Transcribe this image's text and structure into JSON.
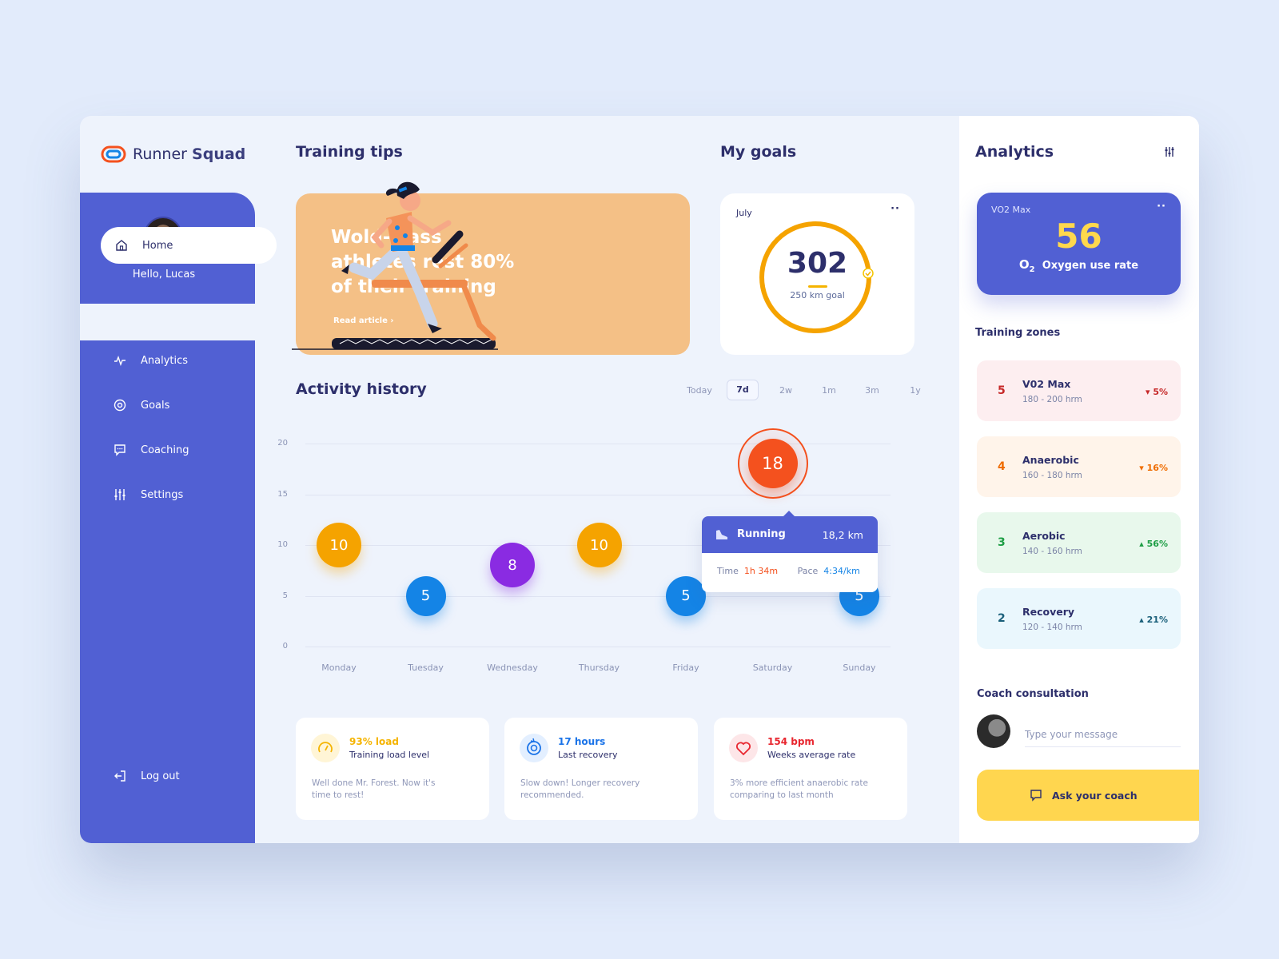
{
  "brand": {
    "name_regular": "Runner",
    "name_bold": "Squad"
  },
  "sidebar": {
    "greeting": "Hello, Lucas",
    "items": [
      {
        "label": "Home",
        "icon": "home-icon",
        "active": true
      },
      {
        "label": "Analytics",
        "icon": "pulse-icon"
      },
      {
        "label": "Goals",
        "icon": "target-icon"
      },
      {
        "label": "Coaching",
        "icon": "chat-icon"
      },
      {
        "label": "Settings",
        "icon": "sliders-icon"
      }
    ],
    "logout": "Log out"
  },
  "tips": {
    "heading": "Training tips",
    "title": "Wold-class athletes rest 80% of their training",
    "link": "Read article"
  },
  "goals": {
    "heading": "My goals",
    "month": "July",
    "value": "302",
    "goal_label": "250 km goal",
    "progress": 1.0
  },
  "activity": {
    "heading": "Activity history",
    "ranges": [
      "Today",
      "7d",
      "2w",
      "1m",
      "3m",
      "1y"
    ],
    "active_range": "7d",
    "tooltip": {
      "activity": "Running",
      "distance": "18,2 km",
      "time_label": "Time",
      "time_value": "1h 34m",
      "pace_label": "Pace",
      "pace_value": "4:34/km"
    }
  },
  "chart_data": {
    "type": "scatter",
    "categories": [
      "Monday",
      "Tuesday",
      "Wednesday",
      "Thursday",
      "Friday",
      "Saturday",
      "Sunday"
    ],
    "values": [
      10,
      5,
      8,
      10,
      5,
      18,
      5
    ],
    "yticks": [
      0,
      5,
      10,
      15,
      20
    ],
    "ylim": [
      0,
      20
    ],
    "grid": true,
    "highlighted": "Saturday"
  },
  "stats": [
    {
      "value": "93% load",
      "label": "Training load level",
      "desc": "Well done Mr. Forest. Now it's time to rest!",
      "color": "#f5b400",
      "icon": "gauge-icon"
    },
    {
      "value": "17 hours",
      "label": "Last recovery",
      "desc": "Slow down! Longer recovery recommended.",
      "color": "#1a73e8",
      "icon": "recovery-icon"
    },
    {
      "value": "154 bpm",
      "label": "Weeks average rate",
      "desc": "3% more efficient  anaerobic rate comparing to last month",
      "color": "#e8262f",
      "icon": "heart-icon"
    }
  ],
  "analytics": {
    "heading": "Analytics",
    "vo2_label": "VO2 Max",
    "vo2_value": "56",
    "vo2_sub": "Oxygen use rate",
    "zones_title": "Training zones",
    "zones": [
      {
        "num": "5",
        "name": "V02 Max",
        "range": "180 - 200 hrm",
        "delta": "5%",
        "dir": "down",
        "bg": "#fdeef0",
        "color": "#c62828"
      },
      {
        "num": "4",
        "name": "Anaerobic",
        "range": "160 - 180 hrm",
        "delta": "16%",
        "dir": "down",
        "bg": "#fff4ea",
        "color": "#ef6c00"
      },
      {
        "num": "3",
        "name": "Aerobic",
        "range": "140 - 160 hrm",
        "delta": "56%",
        "dir": "up",
        "bg": "#e8f8ec",
        "color": "#1e9e45"
      },
      {
        "num": "2",
        "name": "Recovery",
        "range": "120 - 140 hrm",
        "delta": "21%",
        "dir": "up",
        "bg": "#eaf7fd",
        "color": "#1a5f7a"
      }
    ],
    "coach_title": "Coach consultation",
    "coach_placeholder": "Type your message",
    "coach_button": "Ask your coach"
  },
  "colors": {
    "primary": "#5160d3",
    "accent_yellow": "#ffd64f",
    "bubble_orange": "#f5a300",
    "bubble_blue": "#1484e6",
    "bubble_purple": "#8a2be2",
    "bubble_red": "#f4511e"
  }
}
